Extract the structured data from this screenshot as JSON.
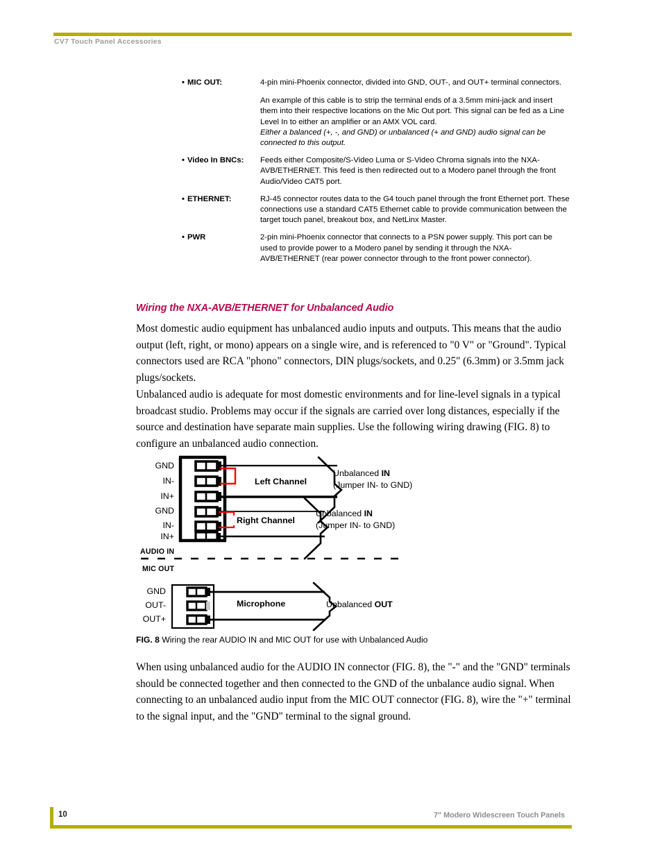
{
  "header": {
    "title": "CV7 Touch Panel Accessories",
    "rule_color": "#b5ad0b"
  },
  "spec_list": [
    {
      "term": "MIC OUT:",
      "bullet": "•",
      "paragraphs": [
        {
          "text": "4-pin mini-Phoenix connector, divided into GND, OUT-, and OUT+ terminal connectors.",
          "italic": false
        },
        {
          "text": "An example of this cable is to strip the terminal ends of a 3.5mm mini-jack and insert them into their respective locations on the Mic Out port. This signal can be fed as a Line Level In to either an amplifier or an AMX VOL card.",
          "italic": false
        },
        {
          "text": "Either a balanced (+, -, and GND) or unbalanced (+ and GND) audio signal can be connected to this output.",
          "italic": true
        }
      ]
    },
    {
      "term": "Video In BNCs:",
      "bullet": "•",
      "paragraphs": [
        {
          "text": "Feeds either Composite/S-Video Luma or S-Video Chroma signals into the NXA-AVB/ETHERNET. This feed is then redirected out to a Modero panel through the front Audio/Video CAT5 port.",
          "italic": false
        }
      ]
    },
    {
      "term": "ETHERNET:",
      "bullet": "•",
      "paragraphs": [
        {
          "text": "RJ-45 connector routes data to the G4 touch panel through the front Ethernet port. These connections use a standard CAT5 Ethernet cable to provide communication between the target touch panel, breakout box, and NetLinx Master.",
          "italic": false
        }
      ]
    },
    {
      "term": "PWR",
      "bullet": "•",
      "paragraphs": [
        {
          "text": "2-pin mini-Phoenix connector that connects to a PSN power supply. This port can be used to provide power to a Modero panel by sending it through the NXA-AVB/ETHERNET (rear power connector through to the front power connector).",
          "italic": false
        }
      ]
    }
  ],
  "section": {
    "heading": "Wiring the NXA-AVB/ETHERNET for Unbalanced Audio",
    "heading_color": "#b50a4d",
    "paragraph_1": "Most domestic audio equipment has unbalanced audio inputs and outputs. This means that the audio output (left, right, or mono) appears on a single wire, and is referenced to \"0 V\" or \"Ground\". Typical connectors used are RCA \"phono\" connectors, DIN plugs/sockets, and 0.25\" (6.3mm) or 3.5mm jack plugs/sockets.",
    "paragraph_2": "Unbalanced audio is adequate for most domestic environments and for line-level signals in a typical broadcast studio. Problems may occur if the signals are carried over long distances, especially if the source and destination have separate main supplies. Use the following wiring drawing (FIG. 8) to configure an unbalanced audio connection.",
    "paragraph_3": "When using unbalanced audio for the AUDIO IN connector (FIG. 8), the \"-\" and the \"GND\" terminals should be connected together and then connected to the GND of the unbalance audio signal. When connecting to an unbalanced audio input from the MIC OUT connector (FIG. 8), wire the \"+\" terminal to the signal input, and the \"GND\" terminal to the signal ground."
  },
  "figure": {
    "caption_number": "FIG. 8",
    "caption_text": "Wiring the rear AUDIO IN and MIC OUT for use with Unbalanced Audio",
    "jumper_color": "#ff0000",
    "wire_color": "#000000",
    "group_labels": {
      "audio_in": "AUDIO IN",
      "mic_out": "MIC OUT"
    },
    "audio_in": {
      "pins": [
        "GND",
        "IN-",
        "IN+",
        "GND",
        "IN-",
        "IN+"
      ],
      "channels": [
        {
          "name": "Left Channel",
          "caption_line_1_prefix": "Unbalanced ",
          "caption_line_1_bold": "IN",
          "caption_line_2": "(Jumper IN- to GND)"
        },
        {
          "name": "Right Channel",
          "caption_line_1_prefix": "Unbalanced ",
          "caption_line_1_bold": "IN",
          "caption_line_2": "(Jumper IN- to GND)"
        }
      ]
    },
    "mic_out": {
      "pins": [
        "GND",
        "OUT-",
        "OUT+"
      ],
      "channels": [
        {
          "name": "Microphone",
          "caption_line_1_prefix": "Unbalanced ",
          "caption_line_1_bold": "OUT",
          "caption_line_2": ""
        }
      ]
    }
  },
  "footer": {
    "page_number": "10",
    "document_title": "7\" Modero Widescreen Touch Panels",
    "rule_color": "#b5ad0b"
  }
}
